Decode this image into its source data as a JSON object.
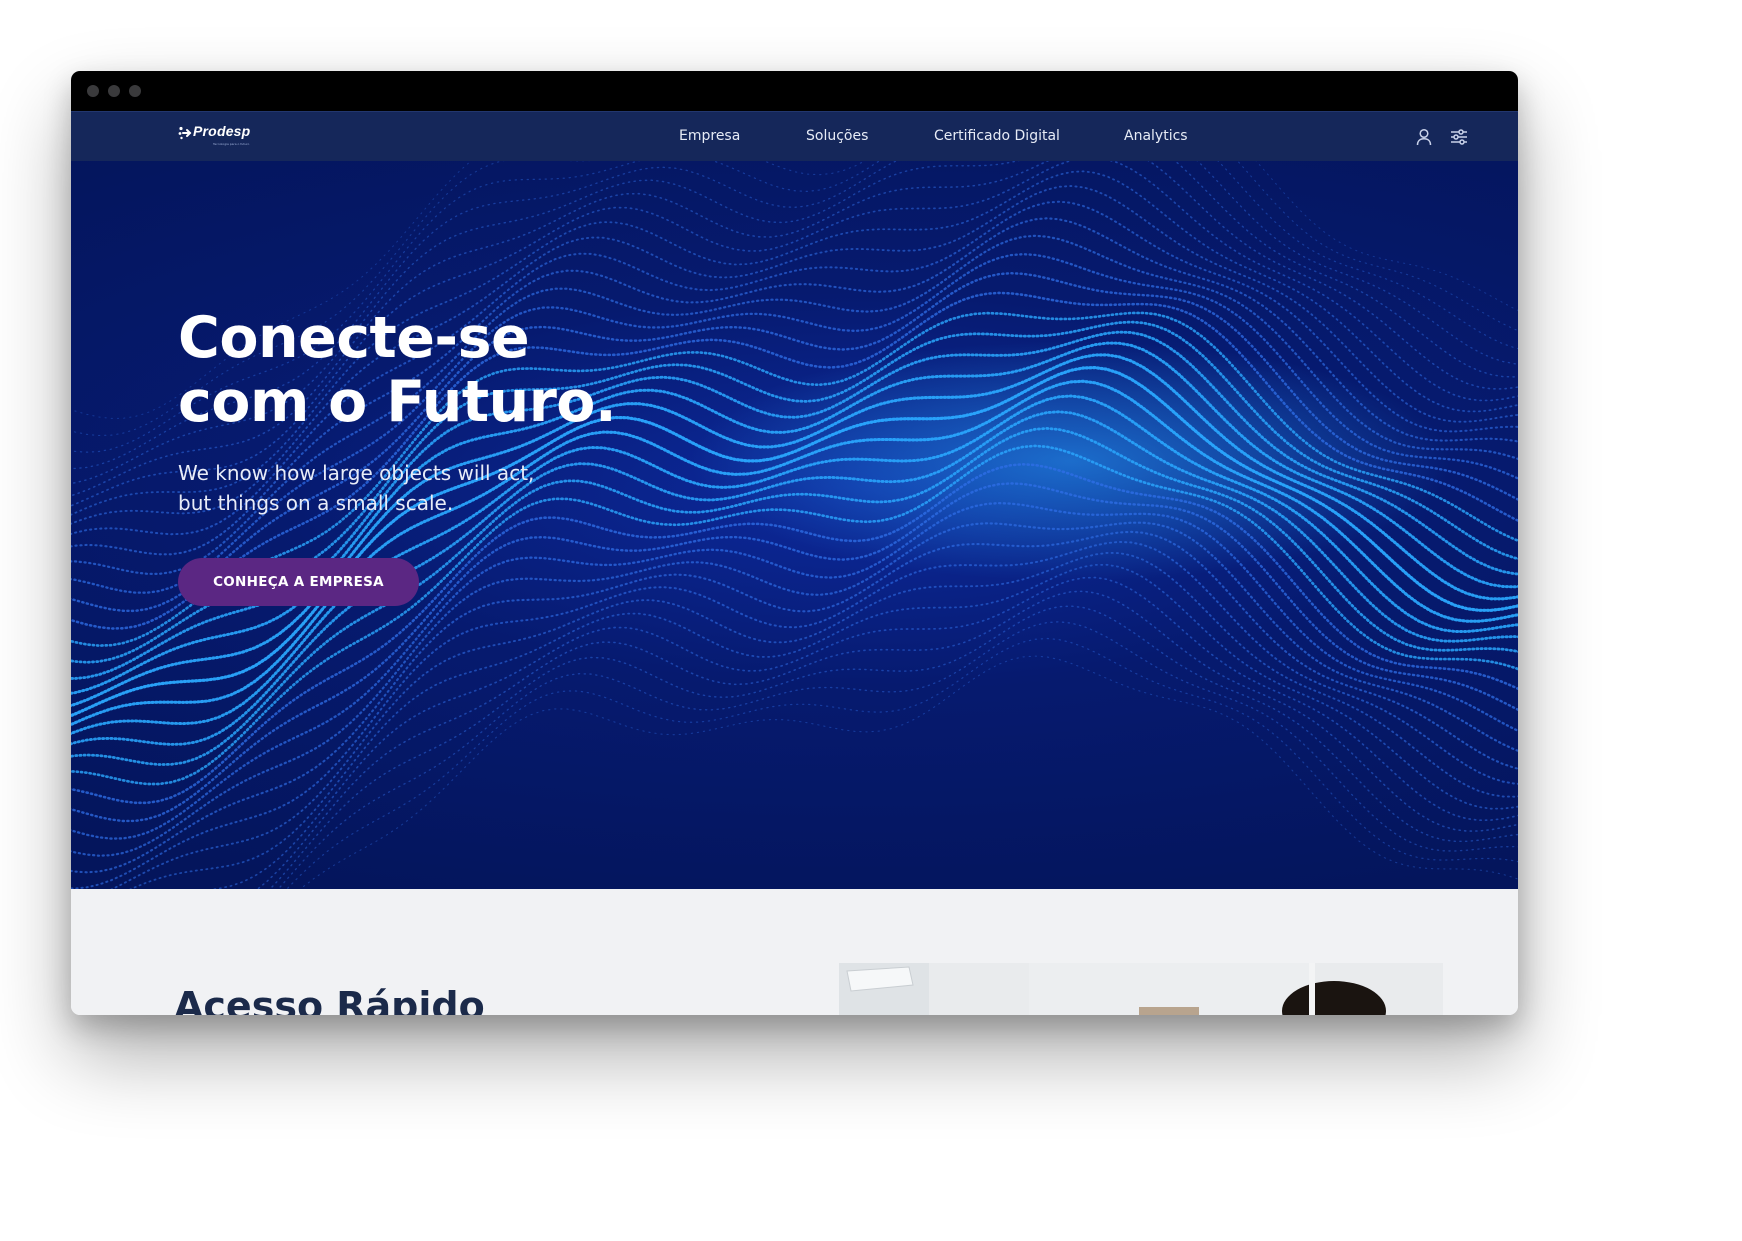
{
  "nav": {
    "logo_text": "Prodesp",
    "logo_tagline": "Tecnologia para o futuro",
    "items": [
      {
        "label": "Empresa"
      },
      {
        "label": "Soluções"
      },
      {
        "label": "Certificado Digital"
      },
      {
        "label": "Analytics"
      }
    ],
    "icons": [
      "user-icon",
      "settings-sliders-icon"
    ]
  },
  "hero": {
    "title_line1": "Conecte-se",
    "title_line2": "com o Futuro.",
    "subtitle_line1": "We know how large objects will act,",
    "subtitle_line2": "but things on a small scale.",
    "cta_label": "CONHEÇA A EMPRESA"
  },
  "quick_access": {
    "title": "Acesso Rápido"
  },
  "colors": {
    "window_chrome": "#000000",
    "navbar_bg": "#15275a",
    "hero_bg": "#061a6f",
    "wave_highlight": "#2aa8ff",
    "cta_bg": "#5b2783",
    "section_bg": "#f1f2f4",
    "heading_text": "#1b2a4a"
  }
}
